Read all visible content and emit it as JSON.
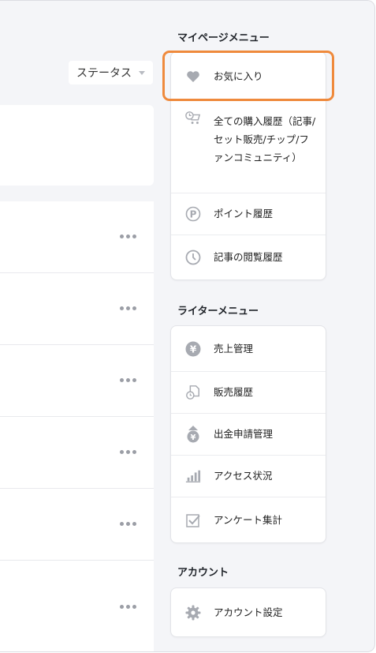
{
  "content": {
    "status_filter": "ステータス",
    "article_rows": [
      "",
      "",
      "",
      "",
      "",
      ""
    ]
  },
  "mypage": {
    "title": "マイページメニュー",
    "items": [
      {
        "label": "お気に入り",
        "icon": "heart-icon"
      },
      {
        "label": "全ての購入履歴（記事/セット販売/チップ/ファンコミュニティ）",
        "icon": "cart-clock-icon"
      },
      {
        "label": "ポイント履歴",
        "icon": "point-p-icon"
      },
      {
        "label": "記事の閲覧履歴",
        "icon": "clock-icon"
      }
    ]
  },
  "writer": {
    "title": "ライターメニュー",
    "items": [
      {
        "label": "売上管理",
        "icon": "yen-icon"
      },
      {
        "label": "販売履歴",
        "icon": "sales-history-icon"
      },
      {
        "label": "出金申請管理",
        "icon": "withdrawal-icon"
      },
      {
        "label": "アクセス状況",
        "icon": "bar-chart-icon"
      },
      {
        "label": "アンケート集計",
        "icon": "checkbox-icon"
      }
    ]
  },
  "account": {
    "title": "アカウント",
    "items": [
      {
        "label": "アカウント設定",
        "icon": "gear-icon"
      }
    ]
  },
  "colors": {
    "highlight": "#ef8a3c",
    "icon": "#a7aab1",
    "background": "#f4f5f8"
  }
}
